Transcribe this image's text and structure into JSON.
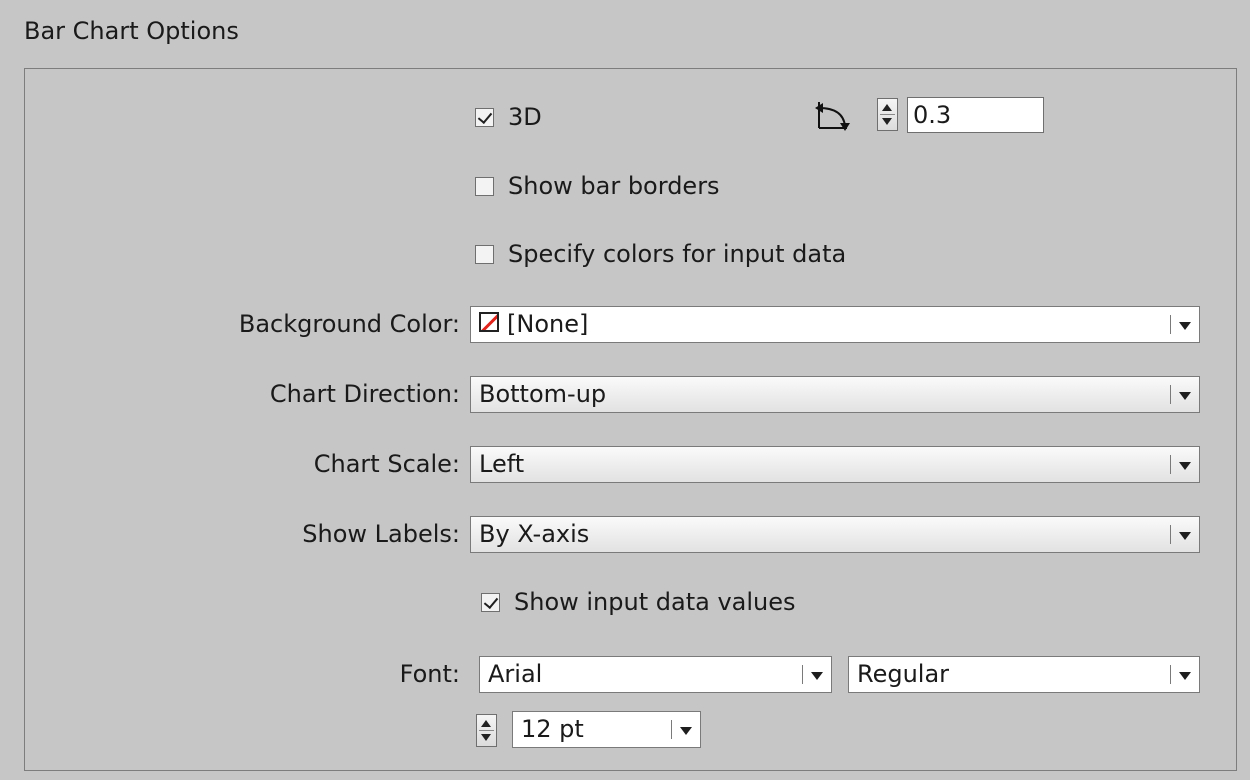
{
  "dialog": {
    "title": "Bar Chart Options"
  },
  "options": {
    "three_d": {
      "label": "3D",
      "checked": true
    },
    "angle": {
      "icon": "angle-icon",
      "value": "0.3"
    },
    "show_bar_borders": {
      "label": "Show bar borders",
      "checked": false
    },
    "specify_colors": {
      "label": "Specify colors for input data",
      "checked": false
    },
    "background_color": {
      "label": "Background Color:",
      "value": "[None]",
      "swatch": "none-swatch-icon"
    },
    "chart_direction": {
      "label": "Chart Direction:",
      "value": "Bottom-up"
    },
    "chart_scale": {
      "label": "Chart Scale:",
      "value": "Left"
    },
    "show_labels": {
      "label": "Show Labels:",
      "value": "By X-axis"
    },
    "show_input_values": {
      "label": "Show input data values",
      "checked": true
    },
    "font": {
      "label": "Font:",
      "family": "Arial",
      "style": "Regular",
      "size": "12 pt"
    }
  },
  "colors": {
    "background": "#c6c6c6",
    "border": "#7d7d7d",
    "none_red": "#e0231b"
  }
}
